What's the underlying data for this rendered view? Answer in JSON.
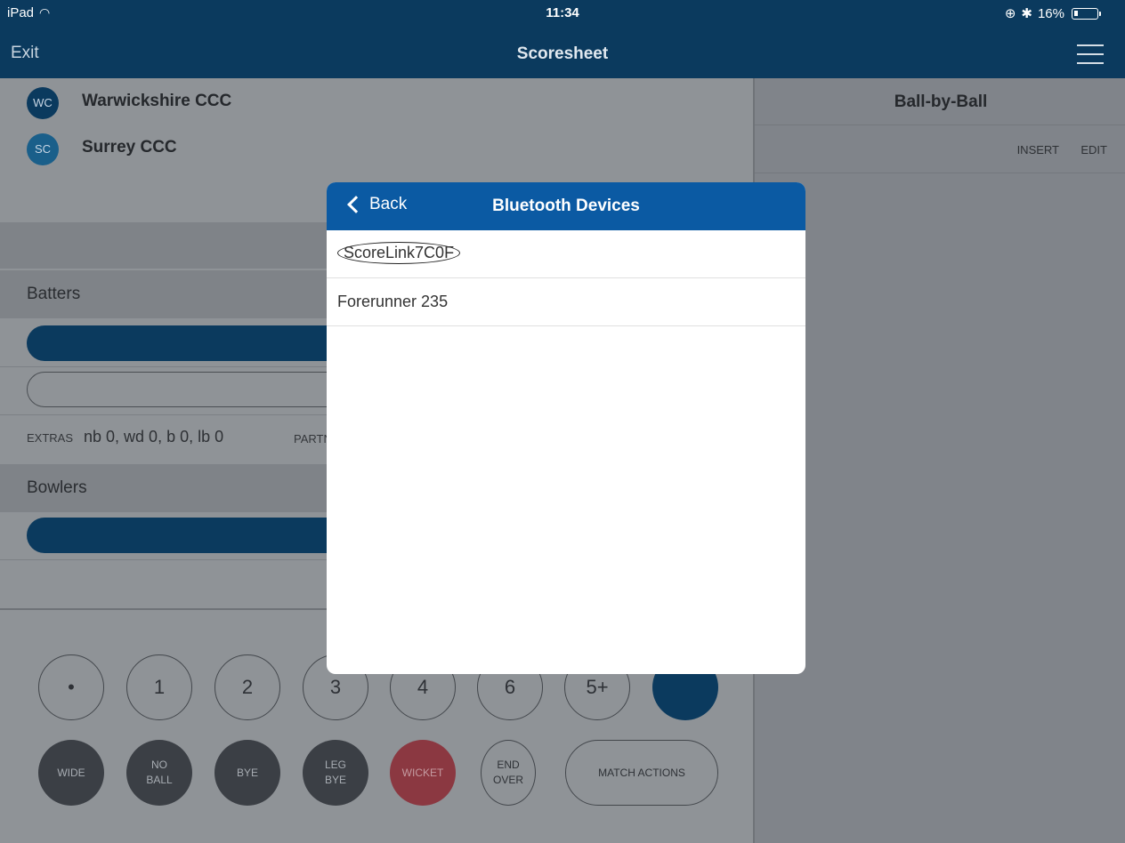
{
  "statusbar": {
    "device": "iPad",
    "time": "11:34",
    "battery": "16%",
    "bluetooth_symbol": "✱",
    "lock_symbol": "⊕"
  },
  "navbar": {
    "exit": "Exit",
    "title": "Scoresheet"
  },
  "teams": [
    {
      "abbr": "WC",
      "name": "Warwickshire CCC",
      "color": "#0b3a5e"
    },
    {
      "abbr": "SC",
      "name": "Surrey CCC",
      "color": "#1a5f8a"
    }
  ],
  "sections": {
    "batters": "Batters",
    "bowlers": "Bowlers"
  },
  "extras": {
    "label": "EXTRAS",
    "value": "nb 0, wd 0, b 0, lb 0",
    "partnership_label": "PARTN"
  },
  "scoring": {
    "row1": [
      "•",
      "1",
      "2",
      "3",
      "4",
      "6",
      "5+"
    ],
    "wide": "WIDE",
    "no_ball": [
      "NO",
      "BALL"
    ],
    "bye": "BYE",
    "leg_bye": [
      "LEG",
      "BYE"
    ],
    "wicket": "WICKET",
    "end_over": [
      "END",
      "OVER"
    ],
    "match_actions": "MATCH ACTIONS"
  },
  "right_panel": {
    "title": "Ball-by-Ball",
    "insert": "INSERT",
    "edit": "EDIT"
  },
  "modal": {
    "back": "Back",
    "title": "Bluetooth Devices",
    "devices": [
      "ScoreLink7C0F",
      "Forerunner 235"
    ]
  }
}
